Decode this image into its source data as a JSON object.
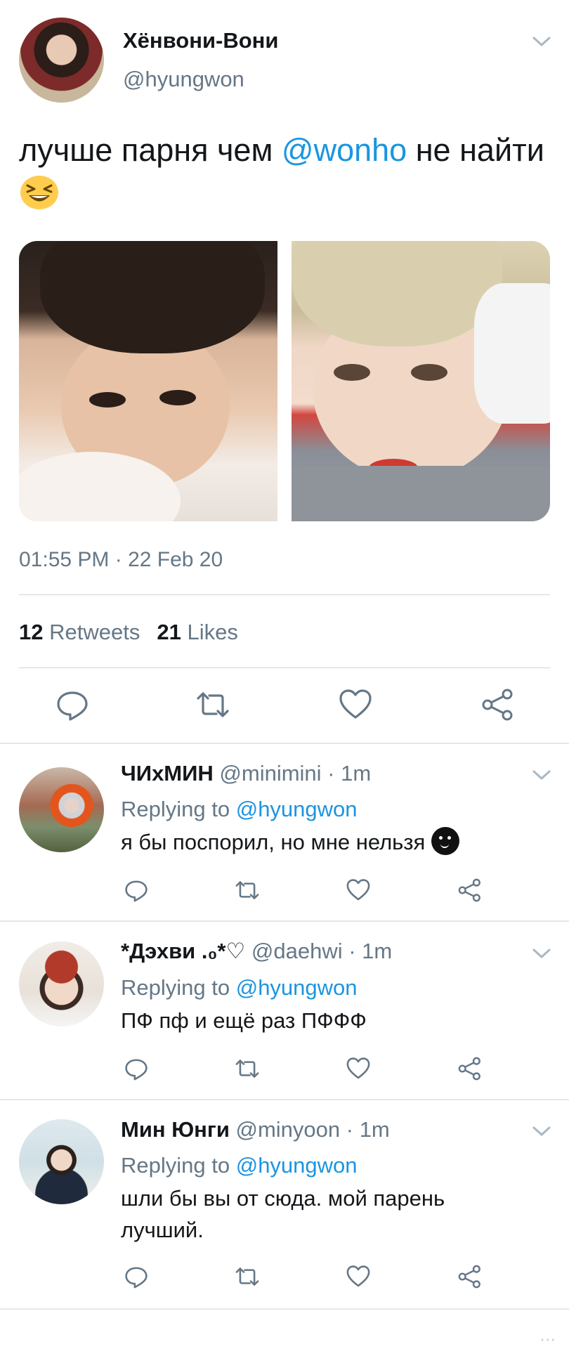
{
  "tweet": {
    "display_name": "Хёнвони-Вони",
    "handle": "@hyungwon",
    "text_before": "лучше парня чем ",
    "mention": "@wonho",
    "text_after": " не найти",
    "emoji": "grinning-squinting-face",
    "images": [
      "photo-1",
      "photo-2"
    ],
    "timestamp": "01:55 PM · 22 Feb 20",
    "retweets_count": "12",
    "retweets_label": "Retweets",
    "likes_count": "21",
    "likes_label": "Likes"
  },
  "actions": [
    "reply-icon",
    "retweet-icon",
    "like-icon",
    "share-icon"
  ],
  "replies": [
    {
      "name": "ЧИхМИН",
      "meta": " @minimini · 1m",
      "replying_prefix": "Replying to ",
      "replying_handle": "@hyungwon",
      "text": "я бы поспорил, но мне нельзя "
    },
    {
      "name": "*Дэхви .₀*♡",
      "meta": " @daehwi · 1m",
      "replying_prefix": "Replying to ",
      "replying_handle": "@hyungwon",
      "text": "ПФ пф и ещё раз ПФФФ"
    },
    {
      "name": "Мин Юнги",
      "meta": " @minyoon · 1m",
      "replying_prefix": "Replying to ",
      "replying_handle": "@hyungwon",
      "text": "шли бы вы от сюда. мой парень лучший."
    }
  ],
  "footer_dots": "...",
  "colors": {
    "link": "#1b95e0",
    "secondary": "#657786",
    "icon": "#657786",
    "divider": "#e1e8ed"
  }
}
